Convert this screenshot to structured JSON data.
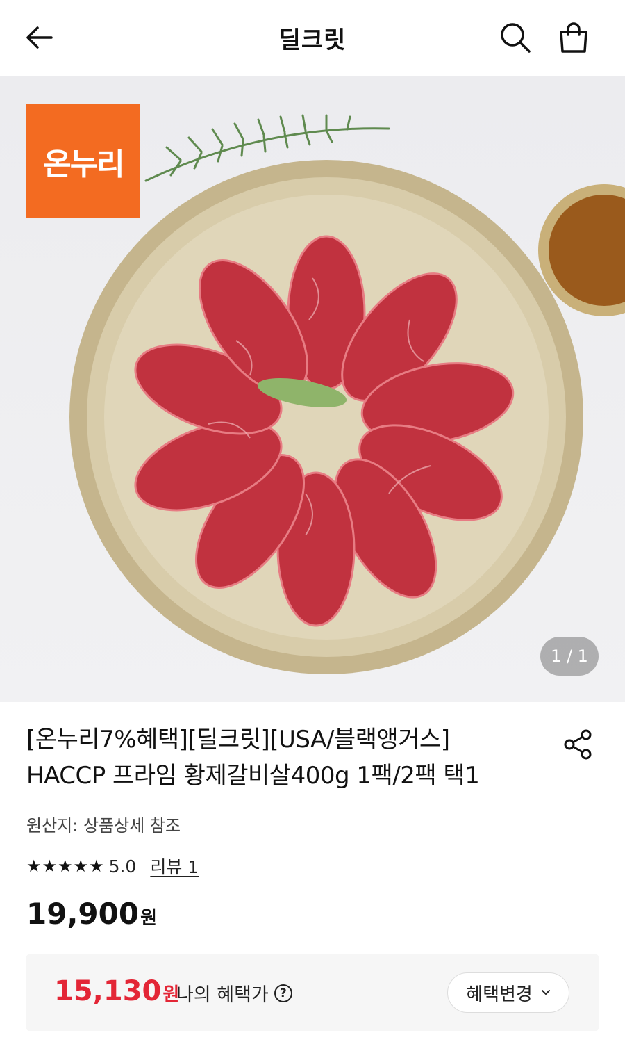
{
  "header": {
    "title": "딜크릿",
    "icons": [
      "back-arrow-icon",
      "search-icon",
      "shopping-bag-icon"
    ]
  },
  "hero": {
    "badge_text": "온누리",
    "badge_color": "#f36b21",
    "page_indicator": "1 / 1"
  },
  "product": {
    "title_line1": "[온누리7%혜택][딜크릿][USA/블랙앵거스]",
    "title_line2": "HACCP 프라임 황제갈비살400g 1팩/2팩 택1",
    "origin": "원산지: 상품상세 참조",
    "stars": "★★★★★",
    "rating": "5.0",
    "review_link": "리뷰 1",
    "price_number": "19,900",
    "price_unit": "원"
  },
  "benefit": {
    "price_number": "15,130",
    "price_unit": "원",
    "label": "나의 혜택가",
    "help": "?",
    "change_button": "혜택변경",
    "accent_color": "#e32636"
  }
}
